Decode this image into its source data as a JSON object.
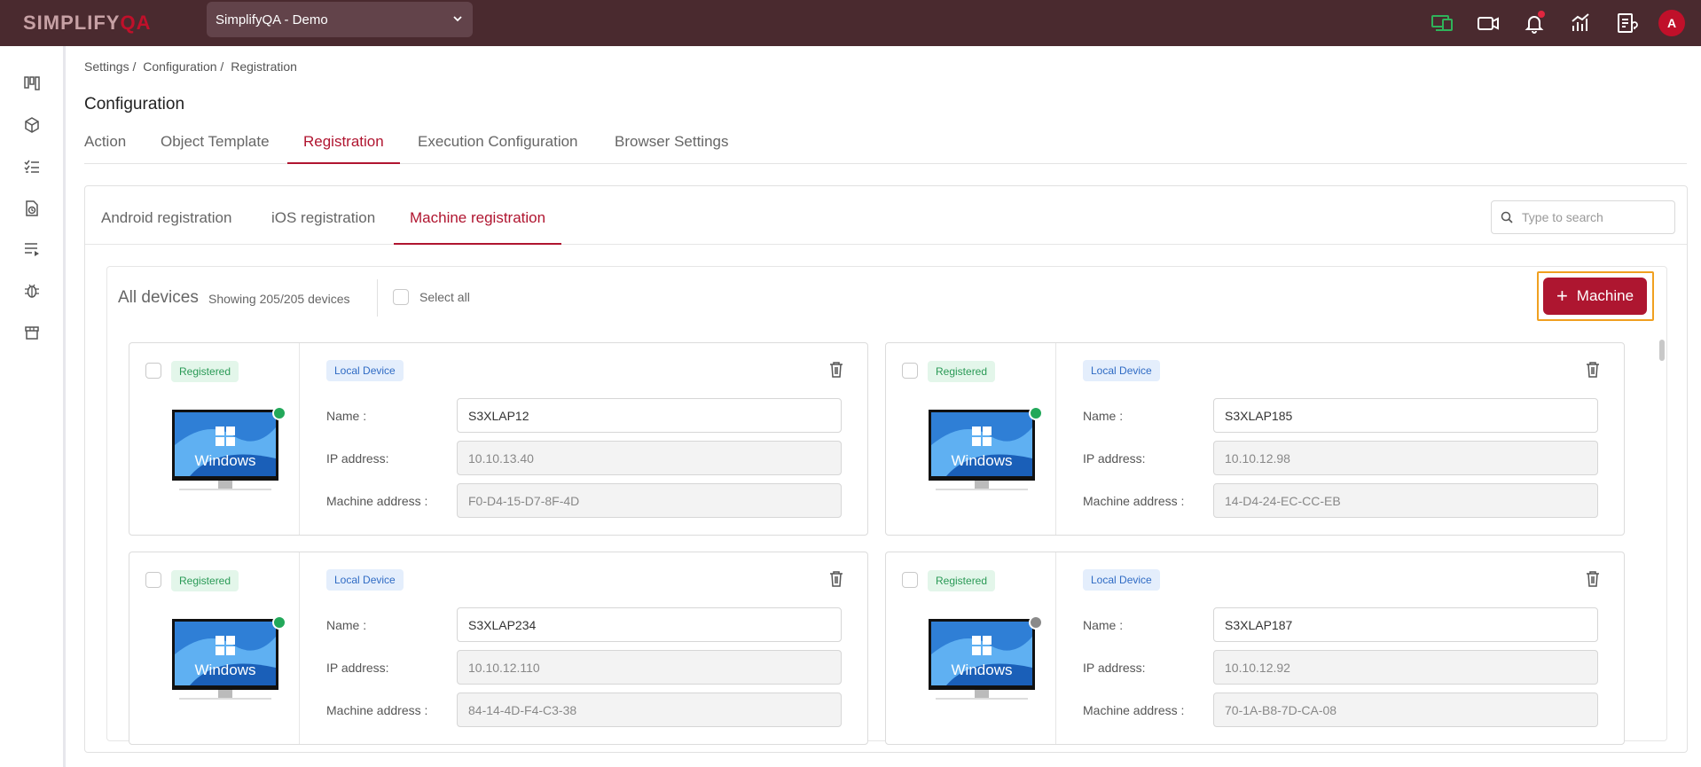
{
  "app": {
    "logo_main": "SIMPLIFY",
    "logo_accent": "QA",
    "project": "SimplifyQA - Demo"
  },
  "topbar_icons": [
    "devices-icon",
    "video-icon",
    "bell-icon",
    "analytics-icon",
    "report-icon"
  ],
  "user": {
    "avatar_initial": "A"
  },
  "sidebar": {
    "items": [
      "kanban-icon",
      "package-icon",
      "checklist-icon",
      "file-clock-icon",
      "playlist-icon",
      "bug-icon",
      "store-icon"
    ]
  },
  "breadcrumb": [
    "Settings /",
    "Configuration /",
    "Registration"
  ],
  "page_title": "Configuration",
  "main_tabs": [
    {
      "label": "Action"
    },
    {
      "label": "Object Template"
    },
    {
      "label": "Registration",
      "active": true
    },
    {
      "label": "Execution Configuration"
    },
    {
      "label": "Browser Settings"
    }
  ],
  "sub_tabs": [
    {
      "label": "Android registration"
    },
    {
      "label": "iOS registration"
    },
    {
      "label": "Machine registration",
      "active": true
    }
  ],
  "search": {
    "placeholder": "Type to search"
  },
  "devices": {
    "title": "All devices",
    "showing": "Showing 205/205 devices",
    "select_all": "Select all",
    "add_label": "Machine",
    "labels": {
      "name": "Name :",
      "ip": "IP address:",
      "mac": "Machine address :"
    },
    "cards": [
      {
        "status": "Registered",
        "type": "Local Device",
        "os": "Windows",
        "online": true,
        "name": "S3XLAP12",
        "ip": "10.10.13.40",
        "mac": "F0-D4-15-D7-8F-4D"
      },
      {
        "status": "Registered",
        "type": "Local Device",
        "os": "Windows",
        "online": true,
        "name": "S3XLAP185",
        "ip": "10.10.12.98",
        "mac": "14-D4-24-EC-CC-EB"
      },
      {
        "status": "Registered",
        "type": "Local Device",
        "os": "Windows",
        "online": true,
        "name": "S3XLAP234",
        "ip": "10.10.12.110",
        "mac": "84-14-4D-F4-C3-38"
      },
      {
        "status": "Registered",
        "type": "Local Device",
        "os": "Windows",
        "online": false,
        "name": "S3XLAP187",
        "ip": "10.10.12.92",
        "mac": "70-1A-B8-7D-CA-08"
      }
    ]
  },
  "colors": {
    "topbar": "#4a2a2f",
    "accent": "#ae1630",
    "highlight": "#f0a020",
    "online": "#22a85a",
    "offline": "#8a8a8a"
  }
}
